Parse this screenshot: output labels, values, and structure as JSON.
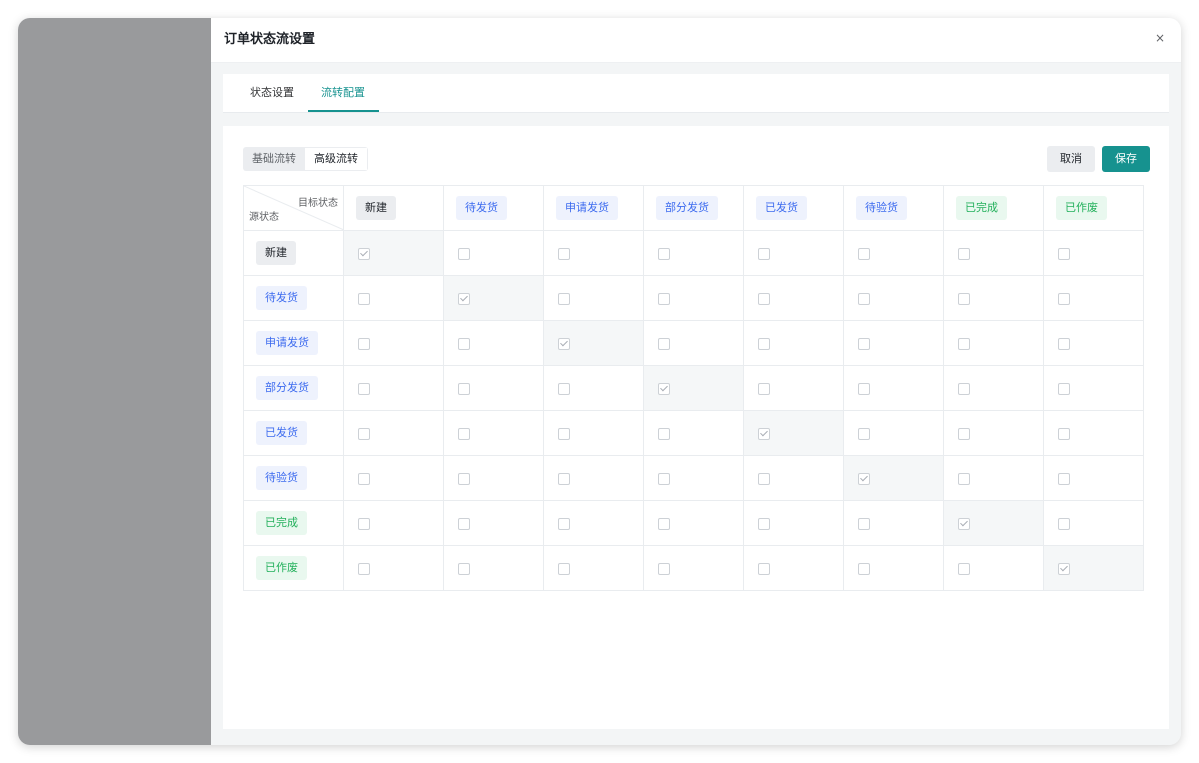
{
  "drawer": {
    "title": "订单状态流设置",
    "close_symbol": "×"
  },
  "tabs": [
    {
      "label": "状态设置",
      "active": false
    },
    {
      "label": "流转配置",
      "active": true
    }
  ],
  "mode_switch": {
    "options": [
      "基础流转",
      "高级流转"
    ],
    "selected": "高级流转"
  },
  "actions": {
    "cancel_label": "取消",
    "save_label": "保存"
  },
  "matrix": {
    "corner_target": "目标状态",
    "corner_source": "源状态",
    "statuses": [
      {
        "label": "新建",
        "style": "gray"
      },
      {
        "label": "待发货",
        "style": "blue"
      },
      {
        "label": "申请发货",
        "style": "blue"
      },
      {
        "label": "部分发货",
        "style": "blue"
      },
      {
        "label": "已发货",
        "style": "blue"
      },
      {
        "label": "待验货",
        "style": "blue"
      },
      {
        "label": "已完成",
        "style": "green"
      },
      {
        "label": "已作废",
        "style": "green"
      }
    ],
    "checked": [
      [
        true,
        false,
        false,
        false,
        false,
        false,
        false,
        false
      ],
      [
        false,
        true,
        false,
        false,
        false,
        false,
        false,
        false
      ],
      [
        false,
        false,
        true,
        false,
        false,
        false,
        false,
        false
      ],
      [
        false,
        false,
        false,
        true,
        false,
        false,
        false,
        false
      ],
      [
        false,
        false,
        false,
        false,
        true,
        false,
        false,
        false
      ],
      [
        false,
        false,
        false,
        false,
        false,
        true,
        false,
        false
      ],
      [
        false,
        false,
        false,
        false,
        false,
        false,
        true,
        false
      ],
      [
        false,
        false,
        false,
        false,
        false,
        false,
        false,
        true
      ]
    ]
  },
  "colors": {
    "accent": "#16928f",
    "tag_blue_text": "#3d6bef",
    "tag_green_text": "#22b05b"
  }
}
